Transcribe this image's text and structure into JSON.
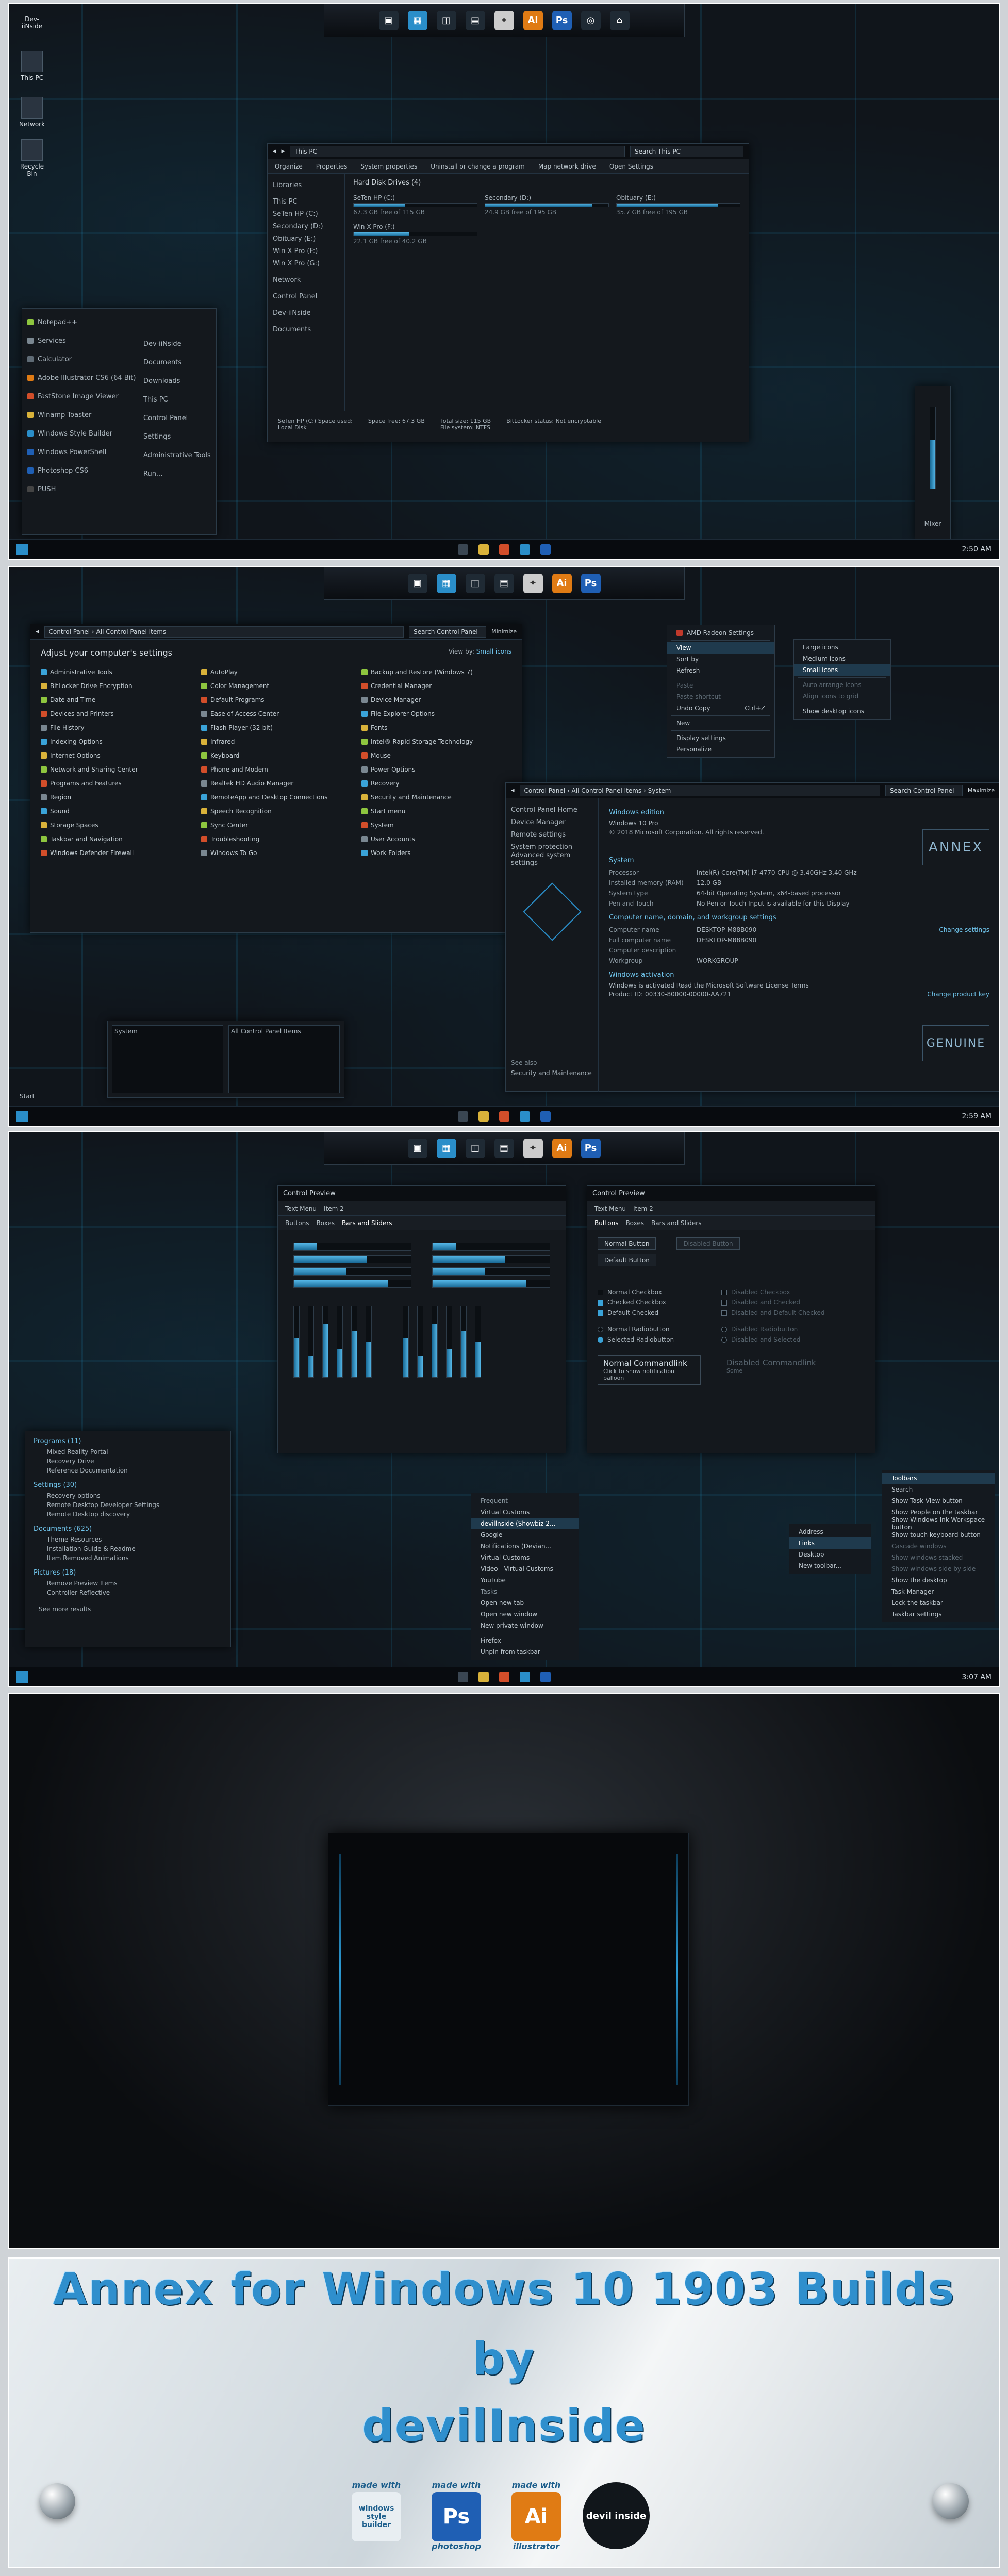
{
  "panel1": {
    "desktop_icons": [
      "Dev-iiNside",
      "This PC",
      "Network",
      "Recycle Bin"
    ],
    "explorer": {
      "breadcrumb": "This PC",
      "search_placeholder": "Search This PC",
      "ribbon": [
        "Organize",
        "Properties",
        "System properties",
        "Uninstall or change a program",
        "Map network drive",
        "Open Settings"
      ],
      "nav": [
        "Libraries",
        "This PC",
        "SeTen HP (C:)",
        "Secondary (D:)",
        "Obituary (E:)",
        "Win X Pro (F:)",
        "Win X Pro (G:)",
        "Network",
        "Control Panel",
        "Dev-iiNside",
        "Documents"
      ],
      "group": "Hard Disk Drives (4)",
      "drives": [
        {
          "name": "SeTen HP (C:)",
          "free": "67.3 GB free of 115 GB"
        },
        {
          "name": "Secondary (D:)",
          "free": "24.9 GB free of 195 GB"
        },
        {
          "name": "Obituary (E:)",
          "free": "35.7 GB free of 195 GB"
        },
        {
          "name": "Win X Pro (F:)",
          "free": "22.1 GB free of 40.2 GB"
        }
      ],
      "details": {
        "drive": "SeTen HP (C:) Space used:",
        "type": "Local Disk",
        "space_free_label": "Space free:",
        "space_free": "67.3 GB",
        "total_label": "Total size:",
        "total": "115 GB",
        "fs_label": "File system:",
        "fs": "NTFS",
        "bitlocker_label": "BitLocker status:",
        "bitlocker": "Not encryptable"
      }
    },
    "start_menu": {
      "left": [
        "Notepad++",
        "Services",
        "Calculator",
        "Adobe Illustrator CS6 (64 Bit)",
        "FastStone Image Viewer",
        "Winamp Toaster",
        "Windows Style Builder",
        "Windows PowerShell",
        "Photoshop CS6",
        "PUSH"
      ],
      "right": [
        "Dev-iiNside",
        "Documents",
        "Downloads",
        "This PC",
        "Control Panel",
        "Settings",
        "Administrative Tools",
        "Run..."
      ]
    },
    "gadget_label": "Mixer",
    "clock": "2:50 AM"
  },
  "panel2": {
    "cp_breadcrumb": [
      "Control Panel",
      "All Control Panel Items"
    ],
    "cp_search": "Search Control Panel",
    "cp_minimize": "Minimize",
    "cp_heading": "Adjust your computer's settings",
    "cp_viewby": "View by:",
    "cp_viewmode": "Small icons",
    "cp_items": [
      [
        "Administrative Tools",
        "BitLocker Drive Encryption",
        "Date and Time",
        "Devices and Printers",
        "File History",
        "Indexing Options",
        "Internet Options",
        "Network and Sharing Center",
        "Programs and Features",
        "Region",
        "Sound",
        "Storage Spaces",
        "Taskbar and Navigation",
        "Windows Defender Firewall"
      ],
      [
        "AutoPlay",
        "Color Management",
        "Default Programs",
        "Ease of Access Center",
        "Flash Player (32-bit)",
        "Infrared",
        "Keyboard",
        "Phone and Modem",
        "Realtek HD Audio Manager",
        "RemoteApp and Desktop Connections",
        "Speech Recognition",
        "Sync Center",
        "Troubleshooting",
        "Windows To Go"
      ],
      [
        "Backup and Restore (Windows 7)",
        "Credential Manager",
        "Device Manager",
        "File Explorer Options",
        "Fonts",
        "Intel® Rapid Storage Technology",
        "Mouse",
        "Power Options",
        "Recovery",
        "Security and Maintenance",
        "Start menu",
        "System",
        "User Accounts",
        "Work Folders"
      ]
    ],
    "context": {
      "header": "AMD Radeon Settings",
      "items": [
        "View",
        "Sort by",
        "Refresh",
        "Paste",
        "Paste shortcut",
        "Undo Copy",
        "New",
        "Display settings",
        "Personalize"
      ],
      "undo_shortcut": "Ctrl+Z",
      "view_sub": [
        "Large icons",
        "Medium icons",
        "Small icons",
        "Auto arrange icons",
        "Align icons to grid",
        "Show desktop icons"
      ]
    },
    "system": {
      "breadcrumb": [
        "Control Panel",
        "All Control Panel Items",
        "System"
      ],
      "search": "Search Control Panel",
      "maximize": "Maximize",
      "side": [
        "Control Panel Home",
        "Device Manager",
        "Remote settings",
        "System protection",
        "Advanced system settings"
      ],
      "see_also": "See also",
      "see_also_item": "Security and Maintenance",
      "edition_head": "Windows edition",
      "edition": "Windows 10 Pro",
      "copyright": "© 2018 Microsoft Corporation. All rights reserved.",
      "system_head": "System",
      "rows": [
        [
          "Processor",
          "Intel(R) Core(TM) i7-4770 CPU @ 3.40GHz  3.40 GHz"
        ],
        [
          "Installed memory (RAM)",
          "12.0 GB"
        ],
        [
          "System type",
          "64-bit Operating System, x64-based processor"
        ],
        [
          "Pen and Touch",
          "No Pen or Touch Input is available for this Display"
        ]
      ],
      "name_head": "Computer name, domain, and workgroup settings",
      "name_rows": [
        [
          "Computer name",
          "DESKTOP-M88B090"
        ],
        [
          "Full computer name",
          "DESKTOP-M88B090"
        ],
        [
          "Computer description",
          ""
        ],
        [
          "Workgroup",
          "WORKGROUP"
        ]
      ],
      "change_settings": "Change settings",
      "activation_head": "Windows activation",
      "activation": "Windows is activated  Read the Microsoft Software License Terms",
      "product_id": "Product ID: 00330-80000-00000-AA721",
      "change_key": "Change product key",
      "logo": "ANNEX",
      "genuine": "GENUINE"
    },
    "thumbs": [
      "System",
      "All Control Panel Items"
    ],
    "start_label": "Start",
    "clock": "2:59 AM"
  },
  "panel3": {
    "preview_title": "Control Preview",
    "tabs_left": [
      "Text Menu",
      "Item 2"
    ],
    "subtabs": [
      "Buttons",
      "Boxes",
      "Bars and Sliders"
    ],
    "buttons": [
      "Normal Button",
      "Default Button",
      "Disabled Button"
    ],
    "checks": [
      "Normal Checkbox",
      "Checked Checkbox",
      "Default Checked",
      "Normal Radiobutton",
      "Selected Radiobutton"
    ],
    "checks_dis": [
      "Disabled Checkbox",
      "Disabled and Checked",
      "Disabled and Default Checked",
      "Disabled Radiobutton",
      "Disabled and Selected"
    ],
    "cmdlink": "Normal Commandlink",
    "cmdlink_sub": "Click to show notification balloon",
    "cmdlink_dis": "Disabled Commandlink",
    "cmdlink_dis_sub": "Some",
    "hbars": [
      0.2,
      0.62,
      0.45,
      0.8
    ],
    "vbars": [
      0.55,
      0.3,
      0.75,
      0.4,
      0.65,
      0.5
    ],
    "search_results": {
      "programs_head": "Programs (11)",
      "programs": [
        "Mixed Reality Portal",
        "Recovery Drive",
        "Reference Documentation"
      ],
      "settings_head": "Settings (30)",
      "settings": [
        "Recovery options",
        "Remote Desktop Developer Settings",
        "Remote Desktop discovery"
      ],
      "documents_head": "Documents (625)",
      "documents": [
        "Theme Resources",
        "Installation Guide & Readme",
        "Item Removed Animations"
      ],
      "pictures_head": "Pictures (18)",
      "pictures": [
        "Remove Preview Items",
        "Controller Reflective"
      ],
      "more": "See more results"
    },
    "jumplist": {
      "frequent": "Frequent",
      "items": [
        "Virtual Customs",
        "devillnside (Showbiz 2...",
        "Google",
        "Notifications (Devian...",
        "Virtual Customs",
        "Video - Virtual Customs",
        "YouTube"
      ],
      "tasks": "Tasks",
      "task_items": [
        "Open new tab",
        "Open new window",
        "New private window"
      ],
      "app": "Firefox",
      "unpin": "Unpin from taskbar"
    },
    "tb_menu": {
      "items": [
        "Address",
        "Links",
        "Desktop",
        "New toolbar..."
      ],
      "right_head": "Toolbars",
      "right": [
        "Search",
        "Show Task View button",
        "Show People on the taskbar",
        "Show Windows Ink Workspace button",
        "Show touch keyboard button",
        "Cascade windows",
        "Show windows stacked",
        "Show windows side by side",
        "Show the desktop",
        "Task Manager",
        "Lock the taskbar",
        "Taskbar settings"
      ]
    },
    "clock": "3:07 AM"
  },
  "banner": {
    "line1": "Annex for Windows 10 1903 Builds",
    "line2": "by",
    "line3": "devilInside",
    "badges": [
      {
        "top": "made with",
        "name": "windows style builder"
      },
      {
        "top": "made with",
        "name": "Ps",
        "bottom": "photoshop"
      },
      {
        "top": "made with",
        "name": "Ai",
        "bottom": "illustrator"
      },
      {
        "top": "",
        "name": "devil inside"
      }
    ]
  }
}
